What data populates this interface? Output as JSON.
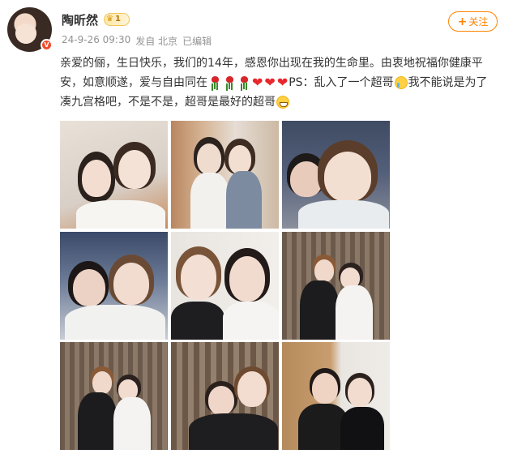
{
  "post": {
    "author": {
      "name": "陶昕然",
      "vip_level": "1",
      "avatar_icon": "user-avatar",
      "verified_icon": "verified-v-icon"
    },
    "meta": {
      "time": "24-9-26 09:30",
      "source": "发自 北京",
      "edited": "已编辑"
    },
    "follow_button": {
      "icon": "plus-icon",
      "label": "关注"
    },
    "content": {
      "text_1": "亲爱的俪，生日快乐，我们的14年，感恩你出现在我的生命里。由衷地祝福你健康平安，如意顺遂，爱与自由同在",
      "text_2": "PS：乱入了一个超哥",
      "text_3": "我不能说是为了凑九宫格吧，不是不是，超哥是最好的超哥",
      "emojis": [
        "rose",
        "rose",
        "rose",
        "heart",
        "heart",
        "heart",
        "cry",
        "grin"
      ]
    },
    "photos": [
      "photo-1",
      "photo-2",
      "photo-3",
      "photo-4",
      "photo-5",
      "photo-6",
      "photo-7",
      "photo-8",
      "photo-9"
    ]
  },
  "colors": {
    "accent": "#ff8200",
    "text": "#333333",
    "meta": "#939393",
    "heart": "#e8272c"
  }
}
